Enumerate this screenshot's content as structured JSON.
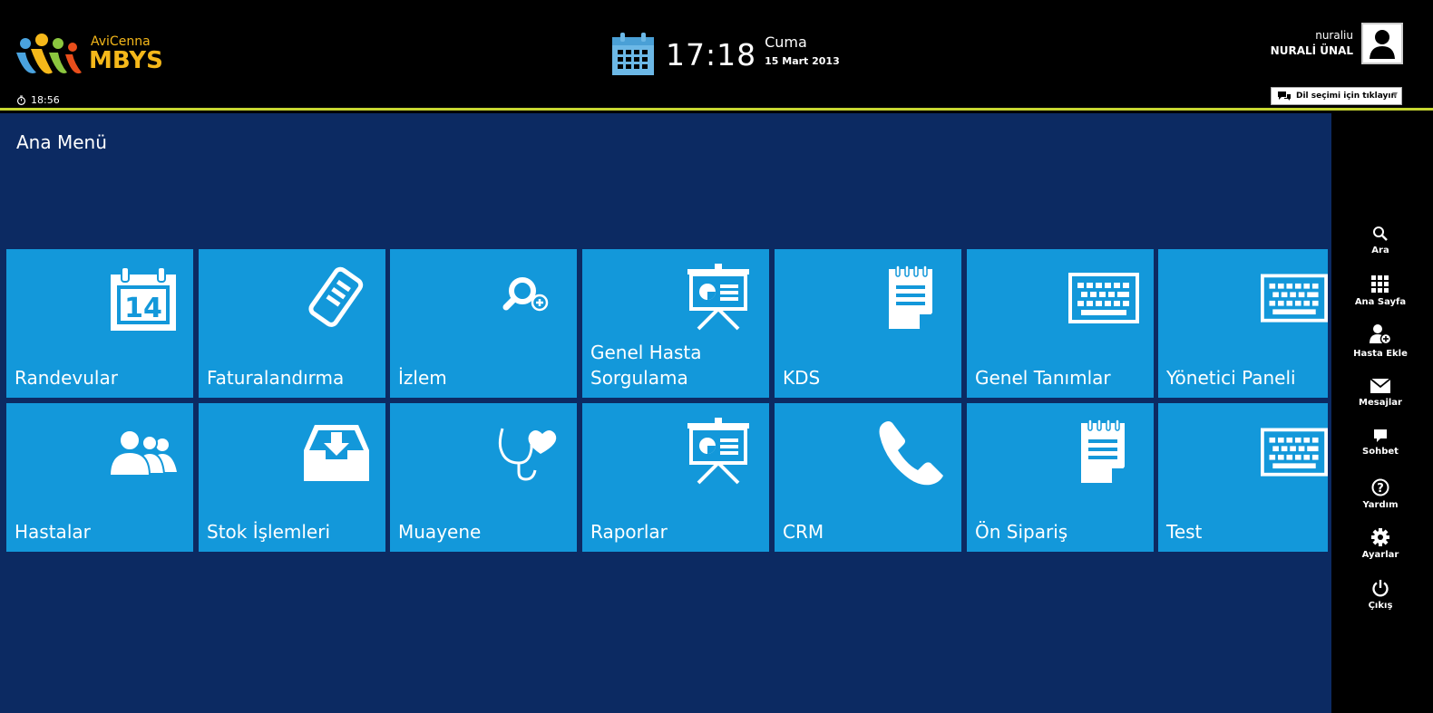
{
  "header": {
    "logo_sub": "AviCenna",
    "logo_main": "MBYS",
    "session_time": "18:56",
    "clock_time": "17:18",
    "day": "Cuma",
    "date": "15 Mart 2013",
    "username": "nuraliu",
    "fullname": "NURALİ ÜNAL",
    "language_select": "Dil seçimi için tıklayın"
  },
  "main": {
    "title": "Ana Menü",
    "tiles": [
      {
        "label": "Randevular",
        "icon": "calendar-icon",
        "cal_day": "14"
      },
      {
        "label": "Faturalandırma",
        "icon": "scroll-icon"
      },
      {
        "label": "İzlem",
        "icon": "search-plus-icon"
      },
      {
        "label": "Genel Hasta Sorgulama",
        "icon": "presentation-icon"
      },
      {
        "label": "KDS",
        "icon": "notepad-icon"
      },
      {
        "label": "Genel Tanımlar",
        "icon": "keyboard-icon"
      },
      {
        "label": "Yönetici Paneli",
        "icon": "keyboard-icon"
      },
      {
        "label": "Hastalar",
        "icon": "users-icon"
      },
      {
        "label": "Stok İşlemleri",
        "icon": "inbox-icon"
      },
      {
        "label": "Muayene",
        "icon": "stethoscope-icon"
      },
      {
        "label": "Raporlar",
        "icon": "presentation-icon"
      },
      {
        "label": "CRM",
        "icon": "phone-icon"
      },
      {
        "label": "Ön Sipariş",
        "icon": "notepad-icon"
      },
      {
        "label": "Test",
        "icon": "keyboard-icon"
      }
    ]
  },
  "charm": {
    "items": [
      {
        "label": "Ara",
        "icon": "search-icon"
      },
      {
        "label": "Ana Sayfa",
        "icon": "grid-icon"
      },
      {
        "label": "Hasta Ekle",
        "icon": "add-user-icon"
      },
      {
        "label": "Mesajlar",
        "icon": "mail-icon"
      },
      {
        "label": "Sohbet",
        "icon": "chat-icon"
      },
      {
        "label": "Yardım",
        "icon": "help-icon"
      },
      {
        "label": "Ayarlar",
        "icon": "gear-icon"
      },
      {
        "label": "Çıkış",
        "icon": "power-icon"
      }
    ]
  },
  "colors": {
    "header_bg": "#000000",
    "accent_line": "#c6d631",
    "main_bg": "#0c2a62",
    "tile_bg": "#1398da",
    "logo": "#f5b81a"
  }
}
